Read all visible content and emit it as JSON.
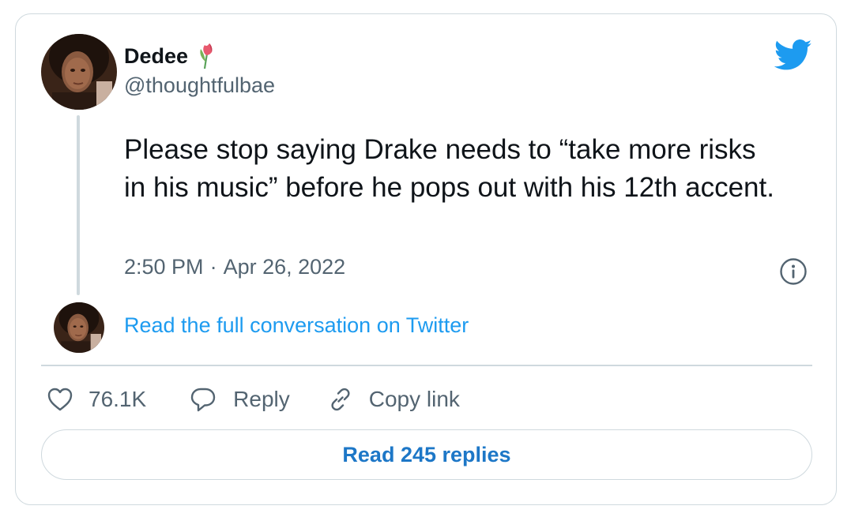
{
  "author": {
    "display_name": "Dedee",
    "handle": "@thoughtfulbae",
    "name_emoji": "tulip-icon"
  },
  "tweet": {
    "text": "Please stop saying Drake needs to “take more risks in his music” before he pops out with his 12th accent.",
    "time": "2:50 PM",
    "separator": "·",
    "date": "Apr 26, 2022"
  },
  "conversation_link": "Read the full conversation on Twitter",
  "actions": {
    "likes_count": "76.1K",
    "reply_label": "Reply",
    "copy_link_label": "Copy link"
  },
  "read_replies_label": "Read 245 replies",
  "icons": {
    "brand": "twitter-bird-icon",
    "info": "info-icon",
    "like": "heart-icon",
    "reply": "speech-bubble-icon",
    "copy": "link-icon"
  },
  "colors": {
    "accent": "#1d9bf0",
    "link_button": "#1d77c7",
    "secondary_text": "#536471",
    "border": "#cfd9de"
  }
}
